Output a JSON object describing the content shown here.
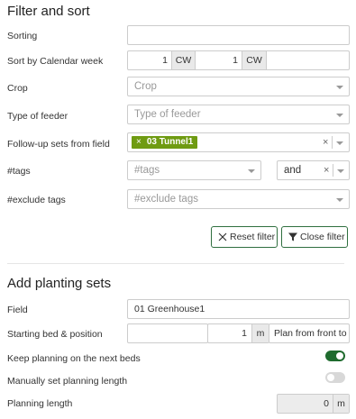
{
  "filter": {
    "title": "Filter and sort",
    "sorting_label": "Sorting",
    "sorting_value": "",
    "calendar_week_label": "Sort by Calendar week",
    "cw_from_value": "1",
    "cw_to_value": "1",
    "cw_unit": "CW",
    "crop_label": "Crop",
    "crop_placeholder": "Crop",
    "feeder_label": "Type of feeder",
    "feeder_placeholder": "Type of feeder",
    "followup_label": "Follow-up sets from field",
    "followup_tag": "03 Tunnel1",
    "followup_tag_remove": "×",
    "clear_symbol": "×",
    "tags_label": "#tags",
    "tags_placeholder": "#tags",
    "tags_operator": "and",
    "exclude_label": "#exclude tags",
    "exclude_placeholder": "#exclude tags",
    "reset_button": "Reset filter",
    "close_button": "Close filter"
  },
  "planting": {
    "title": "Add planting sets",
    "field_label": "Field",
    "field_value": "01 Greenhouse1",
    "start_label": "Starting bed & position",
    "start_bed_value": "",
    "start_position_value": "1",
    "start_unit": "m",
    "plan_direction": "Plan from front to",
    "next_beds_label": "Keep planning on the next beds",
    "next_beds_on": true,
    "manual_length_label": "Manually set planning length",
    "manual_length_on": false,
    "length_label": "Planning length",
    "length_value": "0",
    "length_unit": "m"
  },
  "colors": {
    "accent": "#1f6b2e",
    "tag_green": "#6f9b12"
  }
}
